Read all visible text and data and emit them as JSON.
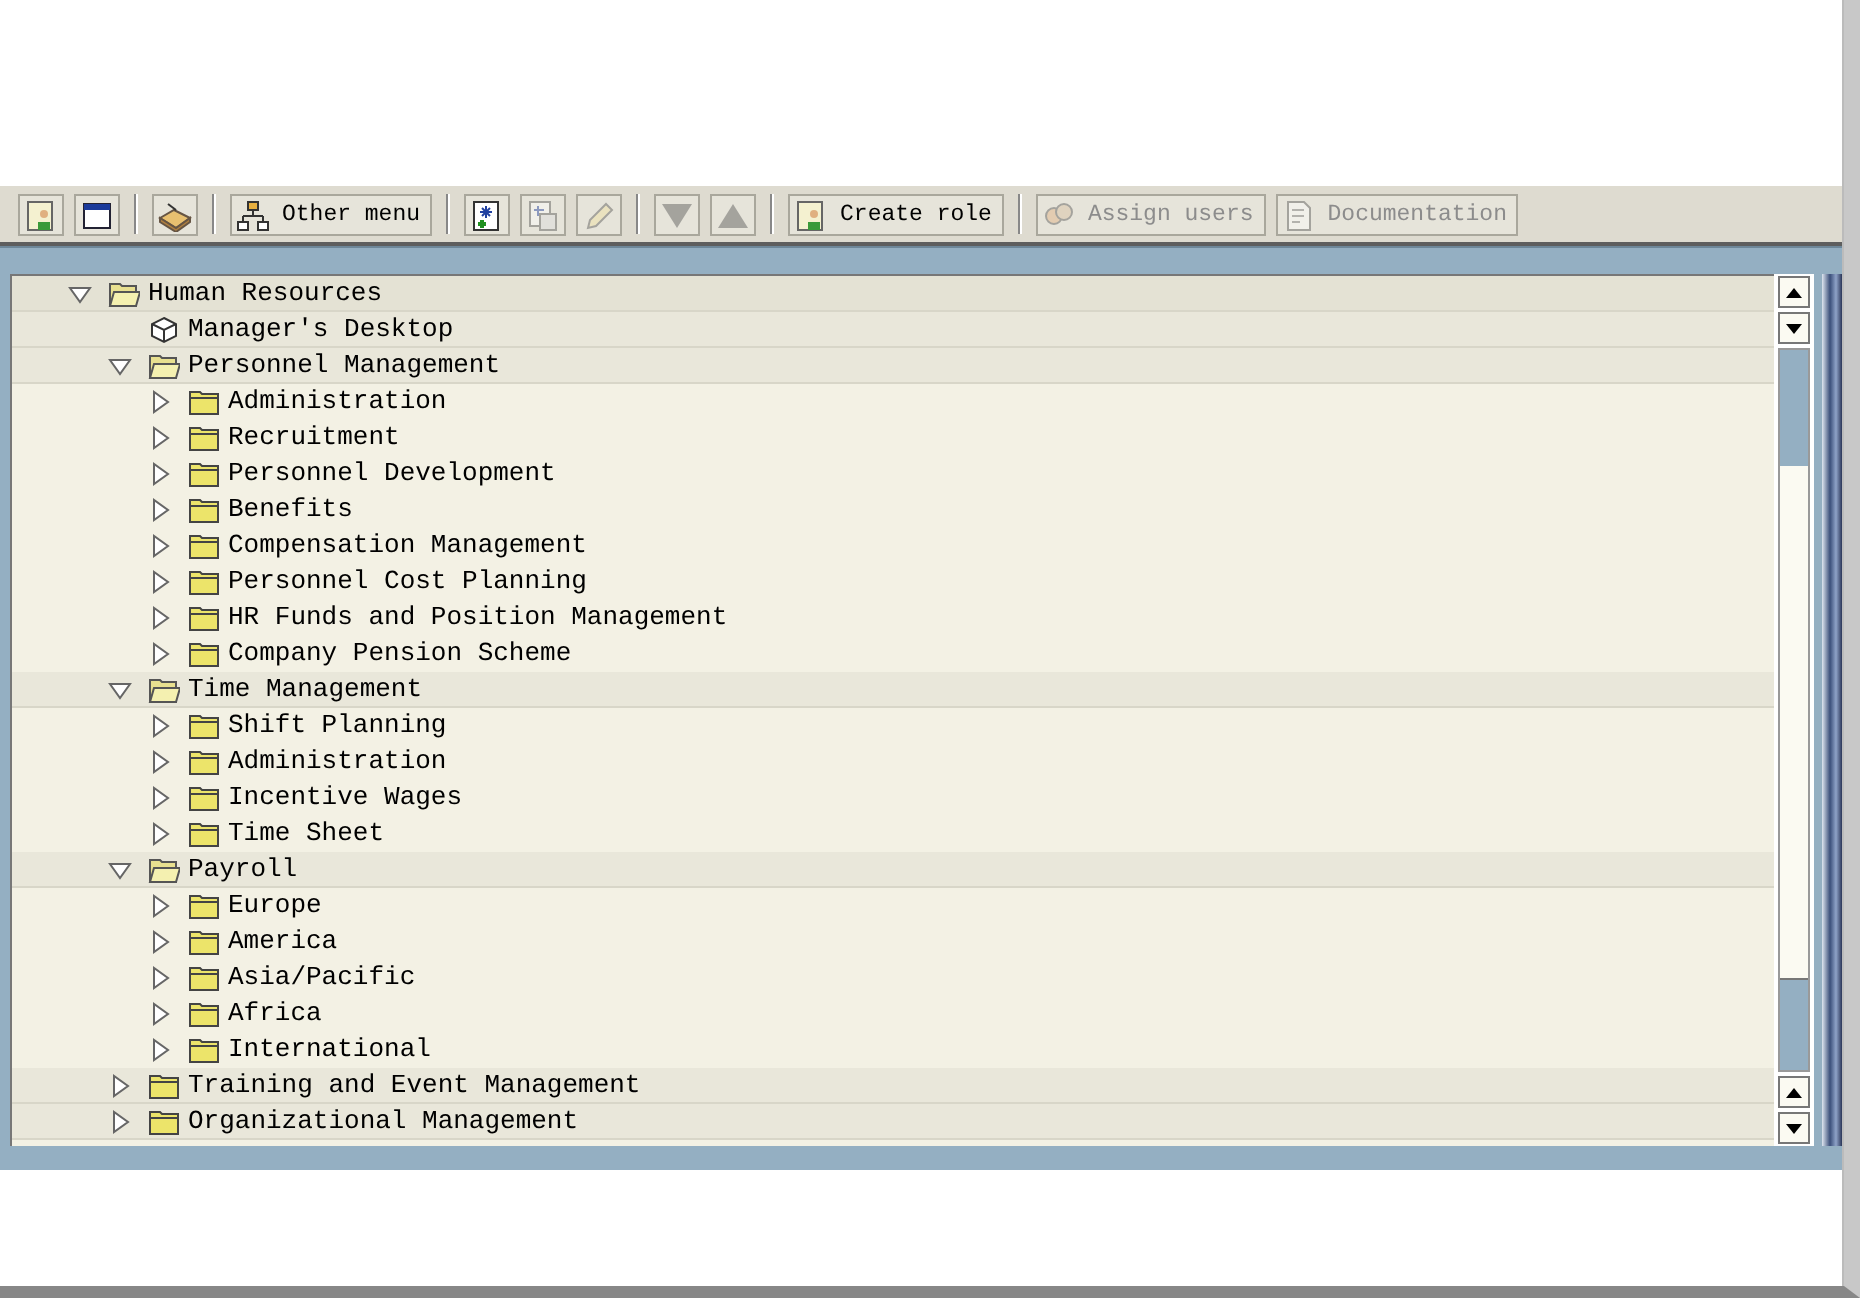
{
  "toolbar": [
    {
      "kind": "icon",
      "disabled": false
    },
    {
      "kind": "icon",
      "disabled": false
    },
    {
      "kind": "separator"
    },
    {
      "kind": "icon",
      "disabled": false
    },
    {
      "kind": "separator"
    },
    {
      "kind": "text",
      "label": "Other menu",
      "disabled": false
    },
    {
      "kind": "separator"
    },
    {
      "kind": "icon",
      "disabled": false
    },
    {
      "kind": "icon",
      "disabled": true
    },
    {
      "kind": "icon",
      "disabled": true
    },
    {
      "kind": "separator"
    },
    {
      "kind": "icon",
      "disabled": true
    },
    {
      "kind": "icon",
      "disabled": true
    },
    {
      "kind": "separator"
    },
    {
      "kind": "text",
      "label": "Create role",
      "disabled": false
    },
    {
      "kind": "separator"
    },
    {
      "kind": "text",
      "label": "Assign users",
      "disabled": true
    },
    {
      "kind": "text",
      "label": "Documentation",
      "disabled": true
    }
  ],
  "tree": [
    {
      "label": "Human Resources",
      "kind": "folder",
      "expanded": true,
      "children": [
        {
          "label": "Manager's Desktop",
          "kind": "item"
        },
        {
          "label": "Personnel Management",
          "kind": "folder",
          "expanded": true,
          "children": [
            {
              "label": "Administration",
              "kind": "folder",
              "expanded": false
            },
            {
              "label": "Recruitment",
              "kind": "folder",
              "expanded": false
            },
            {
              "label": "Personnel Development",
              "kind": "folder",
              "expanded": false
            },
            {
              "label": "Benefits",
              "kind": "folder",
              "expanded": false
            },
            {
              "label": "Compensation Management",
              "kind": "folder",
              "expanded": false
            },
            {
              "label": "Personnel Cost Planning",
              "kind": "folder",
              "expanded": false
            },
            {
              "label": "HR Funds and Position Management",
              "kind": "folder",
              "expanded": false
            },
            {
              "label": "Company Pension Scheme",
              "kind": "folder",
              "expanded": false
            }
          ]
        },
        {
          "label": "Time Management",
          "kind": "folder",
          "expanded": true,
          "children": [
            {
              "label": "Shift Planning",
              "kind": "folder",
              "expanded": false
            },
            {
              "label": "Administration",
              "kind": "folder",
              "expanded": false
            },
            {
              "label": "Incentive Wages",
              "kind": "folder",
              "expanded": false
            },
            {
              "label": "Time Sheet",
              "kind": "folder",
              "expanded": false
            }
          ]
        },
        {
          "label": "Payroll",
          "kind": "folder",
          "expanded": true,
          "children": [
            {
              "label": "Europe",
              "kind": "folder",
              "expanded": false
            },
            {
              "label": "America",
              "kind": "folder",
              "expanded": false
            },
            {
              "label": "Asia/Pacific",
              "kind": "folder",
              "expanded": false
            },
            {
              "label": "Africa",
              "kind": "folder",
              "expanded": false
            },
            {
              "label": "International",
              "kind": "folder",
              "expanded": false
            }
          ]
        },
        {
          "label": "Training and Event Management",
          "kind": "folder",
          "expanded": false
        },
        {
          "label": "Organizational Management",
          "kind": "folder",
          "expanded": false
        }
      ]
    }
  ]
}
